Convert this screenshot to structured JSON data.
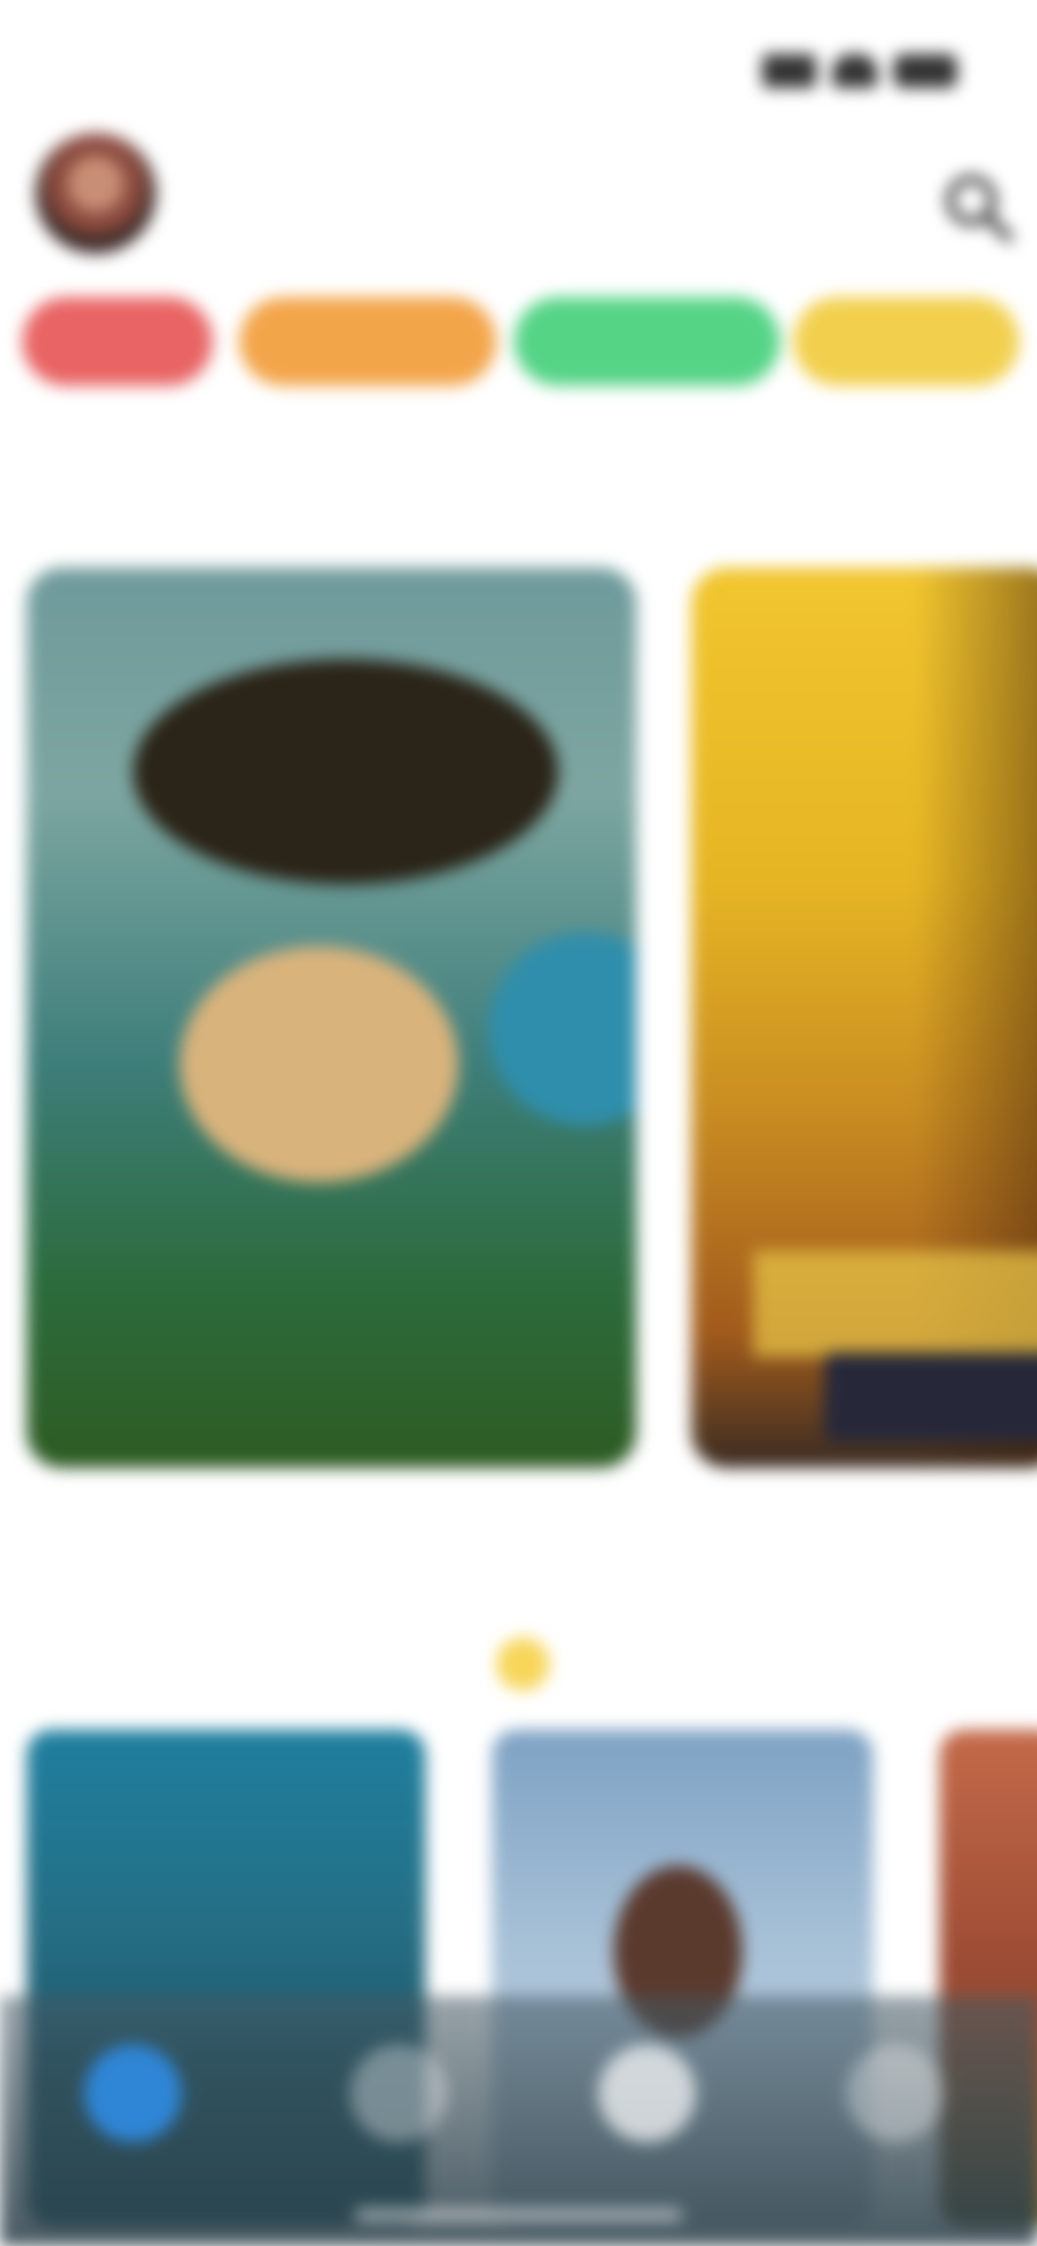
{
  "status_bar": {
    "time": "",
    "signal_icon": "signal-icon",
    "wifi_icon": "wifi-icon",
    "battery_icon": "battery-icon"
  },
  "header": {
    "title": "",
    "avatar_icon": "avatar",
    "search_icon": "search-icon"
  },
  "genres": [
    {
      "label": "",
      "color": "#E96464"
    },
    {
      "label": "",
      "color": "#F3A54A"
    },
    {
      "label": "",
      "color": "#55D486"
    },
    {
      "label": "",
      "color": "#F2D04E"
    }
  ],
  "sections": {
    "featured": {
      "title": "",
      "cards": [
        {
          "caption": ""
        },
        {
          "caption": ""
        }
      ]
    },
    "popular": {
      "title": "",
      "badge_color": "#F7D65A",
      "cards": [
        {
          "caption": ""
        },
        {
          "caption": ""
        },
        {
          "caption": ""
        }
      ]
    }
  },
  "tab_bar": {
    "items": [
      {
        "icon": "home-icon",
        "active": true,
        "color": "#2F86D6"
      },
      {
        "icon": "explore-icon",
        "active": false
      },
      {
        "icon": "play-icon",
        "active": false
      },
      {
        "icon": "profile-icon",
        "active": false
      }
    ]
  }
}
